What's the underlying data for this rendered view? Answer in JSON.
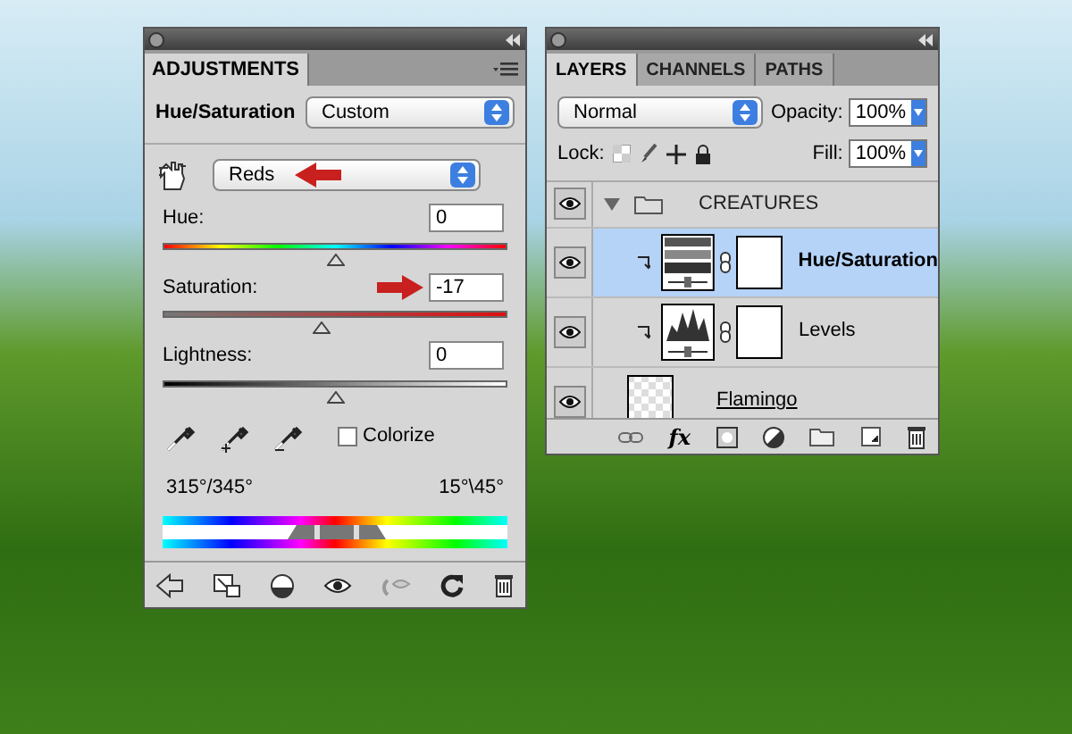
{
  "adjustments": {
    "title": "ADJUSTMENTS",
    "preset_label": "Hue/Saturation",
    "preset": "Custom",
    "channel": "Reds",
    "sliders": [
      {
        "kind": "hue",
        "label": "Hue:",
        "value": "0",
        "level": 0.5
      },
      {
        "kind": "saturation",
        "label": "Saturation:",
        "value": "-17",
        "level": 0.46
      },
      {
        "kind": "lightness",
        "label": "Lightness:",
        "value": "0",
        "level": 0.5
      }
    ],
    "colorize": {
      "label": "Colorize",
      "checked": false
    },
    "range_left": "315°/345°",
    "range_right": "15°\\45°"
  },
  "layers_panel": {
    "tabs": [
      {
        "label": "LAYERS",
        "selected": true
      },
      {
        "label": "CHANNELS",
        "selected": false
      },
      {
        "label": "PATHS",
        "selected": false
      }
    ],
    "blend_mode": "Normal",
    "opacity_label": "Opacity:",
    "opacity": "100%",
    "lock_label": "Lock:",
    "fill_label": "Fill:",
    "fill": "100%",
    "fx_label": "fx",
    "layers": [
      {
        "kind": "group",
        "name": "CREATURES",
        "visible": true,
        "expanded": true,
        "selected": false,
        "children": [
          {
            "kind": "hue_saturation",
            "name": "Hue/Saturation",
            "visible": true,
            "selected": true
          },
          {
            "kind": "levels",
            "name": "Levels",
            "visible": true,
            "selected": false
          }
        ]
      },
      {
        "kind": "pixel",
        "name": "Flamingo",
        "visible": true,
        "selected": false
      }
    ]
  }
}
